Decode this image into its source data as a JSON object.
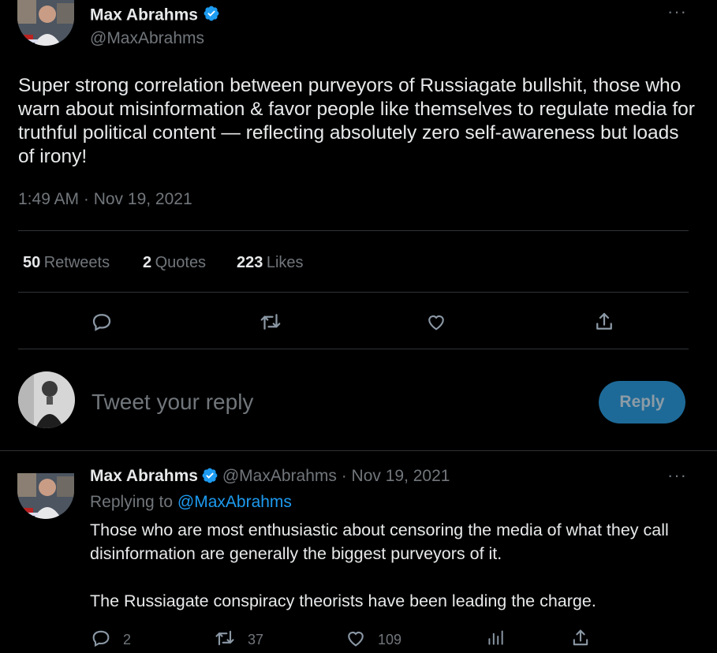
{
  "main_tweet": {
    "author_name": "Max Abrahms",
    "author_handle": "@MaxAbrahms",
    "text": "Super strong correlation between purveyors of Russiagate bullshit, those who warn about misinformation & favor people like themselves to regulate media for truthful political content — reflecting absolutely zero self-awareness but loads of irony!",
    "timestamp": "1:49 AM · Nov 19, 2021",
    "stats": {
      "retweets_count": "50",
      "retweets_label": "Retweets",
      "quotes_count": "2",
      "quotes_label": "Quotes",
      "likes_count": "223",
      "likes_label": "Likes"
    },
    "more_label": "···"
  },
  "compose": {
    "placeholder": "Tweet your reply",
    "button_label": "Reply"
  },
  "reply_tweet": {
    "author_name": "Max Abrahms",
    "handle_and_date": "@MaxAbrahms · Nov 19, 2021",
    "replying_prefix": "Replying to",
    "replying_handle": "@MaxAbrahms",
    "paragraph1": "Those who are most enthusiastic about censoring the media of what they call disinformation are generally the biggest purveyors of it.",
    "paragraph2": "The Russiagate conspiracy theorists have been leading the charge.",
    "reply_count": "2",
    "retweet_count": "37",
    "like_count": "109",
    "more_label": "···"
  },
  "colors": {
    "background": "#000000",
    "text": "#e7e9ea",
    "muted": "#71767b",
    "accent": "#1d9bf0",
    "divider": "#2f3336"
  },
  "icons": [
    "verified-badge-icon",
    "more-icon",
    "reply-icon",
    "retweet-icon",
    "like-icon",
    "share-icon",
    "analytics-icon"
  ]
}
